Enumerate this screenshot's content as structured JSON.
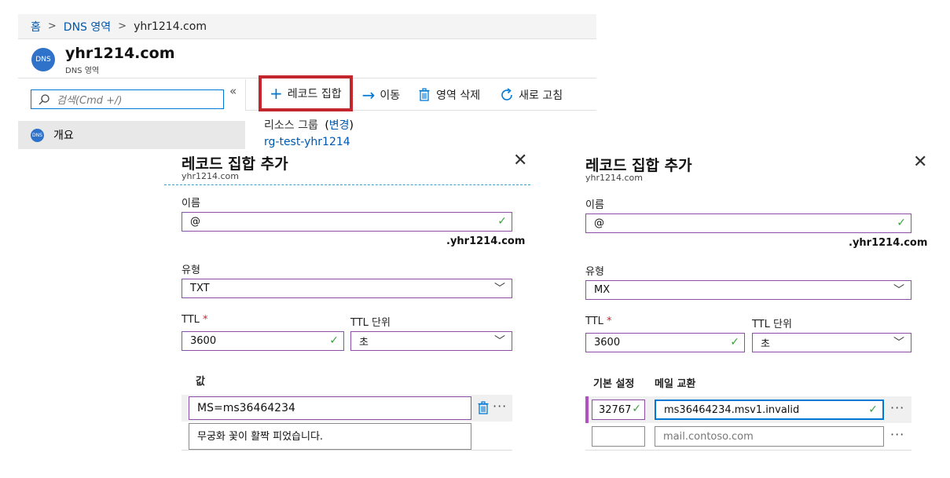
{
  "breadcrumb": {
    "home": "홈",
    "dns_zones": "DNS 영역",
    "current": "yhr1214.com"
  },
  "resource": {
    "icon_text": "DNS",
    "title": "yhr1214.com",
    "subtitle": "DNS 영역"
  },
  "left_nav": {
    "search_placeholder": "검색(Cmd +/)",
    "collapse_glyph": "«",
    "overview_icon_text": "DNS",
    "overview_label": "개요"
  },
  "toolbar": {
    "add_recordset": "레코드 집합",
    "move": "이동",
    "delete_zone": "영역 삭제",
    "refresh": "새로 고침"
  },
  "essentials": {
    "resource_group_label": "리소스 그룹",
    "change_open": "(",
    "change_link": "변경",
    "change_close": ")",
    "resource_group_value": "rg-test-yhr1214"
  },
  "panel_txt": {
    "title": "레코드 집합 추가",
    "subtitle": "yhr1214.com",
    "name_label": "이름",
    "name_value": "@",
    "zone_suffix": ".yhr1214.com",
    "type_label": "유형",
    "type_value": "TXT",
    "ttl_label": "TTL",
    "required_mark": "*",
    "ttl_value": "3600",
    "ttl_unit_label": "TTL 단위",
    "ttl_unit_value": "초",
    "value_label": "값",
    "value_1": "MS=ms36464234",
    "value_2": "무궁화 꽃이 활짝 피었습니다.",
    "more_glyph": "···"
  },
  "panel_mx": {
    "title": "레코드 집합 추가",
    "subtitle": "yhr1214.com",
    "name_label": "이름",
    "name_value": "@",
    "zone_suffix": ".yhr1214.com",
    "type_label": "유형",
    "type_value": "MX",
    "ttl_label": "TTL",
    "required_mark": "*",
    "ttl_value": "3600",
    "ttl_unit_label": "TTL 단위",
    "ttl_unit_value": "초",
    "col_preference": "기본 설정",
    "col_exchange": "메일 교환",
    "pref_1": "32767",
    "exchange_1": "ms36464234.msv1.invalid",
    "exchange_2_placeholder": "mail.contoso.com",
    "more_glyph": "···"
  },
  "colors": {
    "accent": "#0078d4",
    "highlight_border": "#c4262e",
    "field_border": "#8c4fa8",
    "valid_check": "#3ca03c"
  }
}
